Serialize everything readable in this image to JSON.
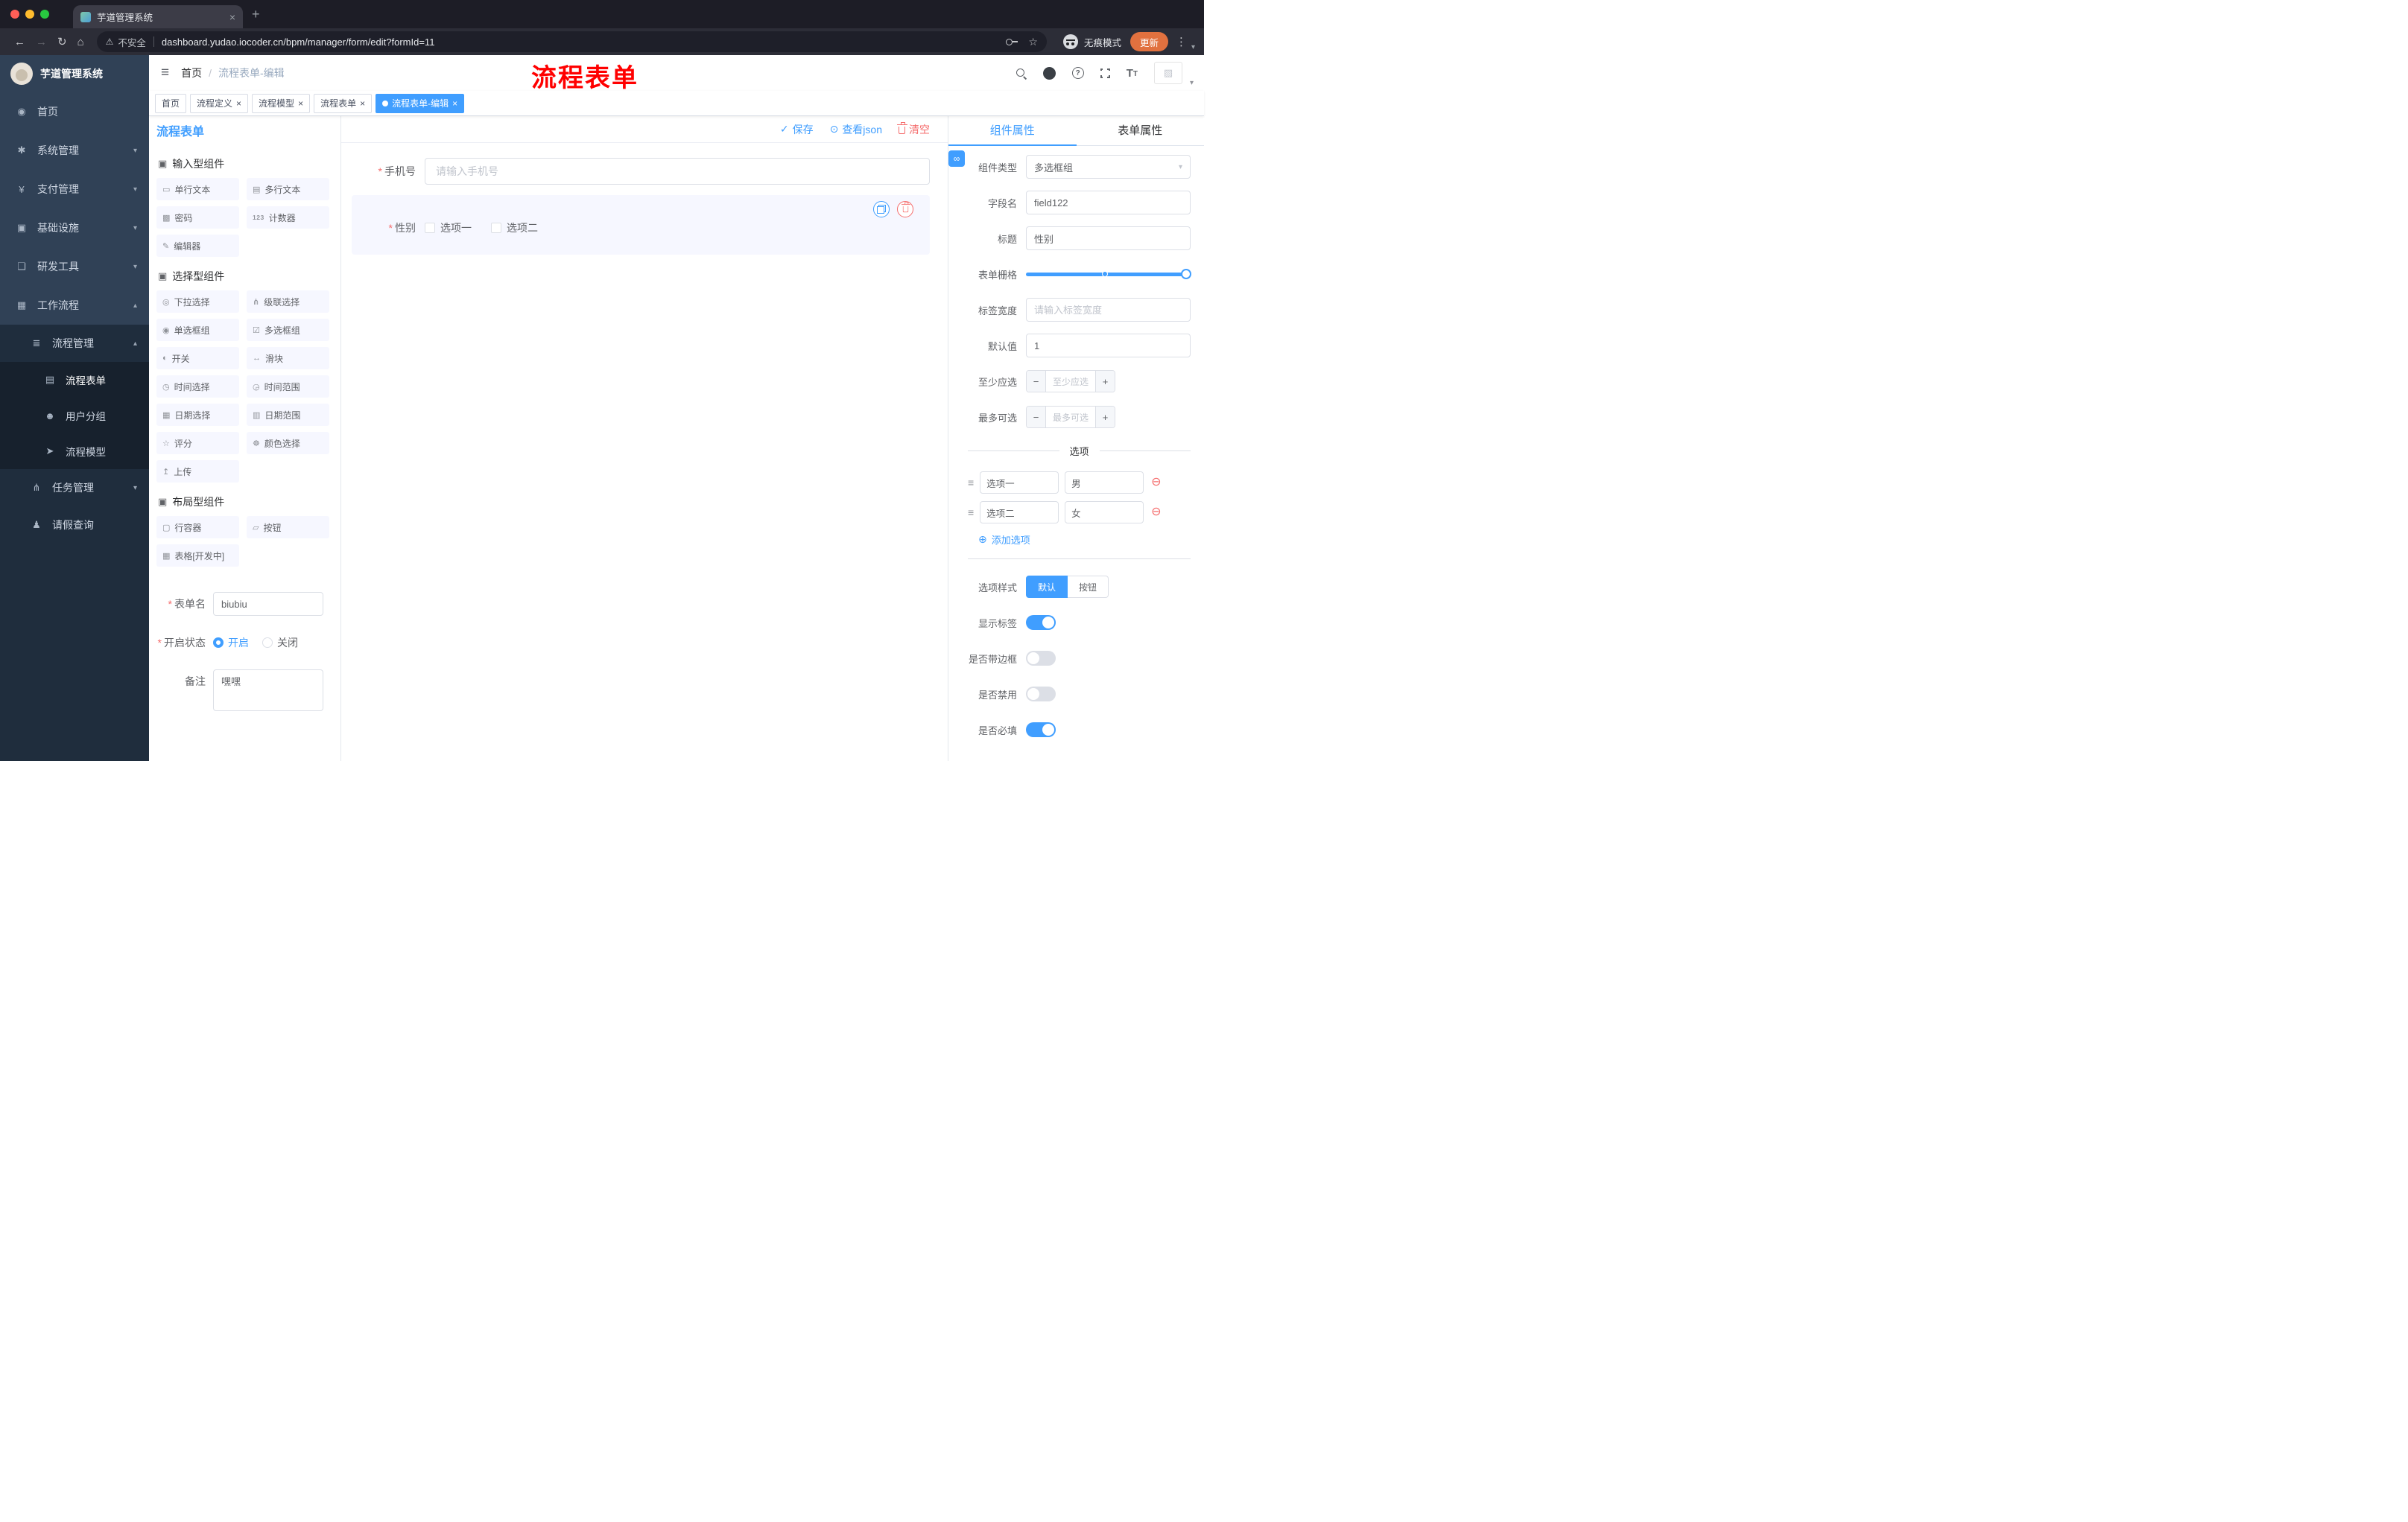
{
  "browser": {
    "tab_title": "芋道管理系统",
    "security_label": "不安全",
    "url": "dashboard.yudao.iocoder.cn/bpm/manager/form/edit?formId=11",
    "incognito_label": "无痕模式",
    "update_label": "更新"
  },
  "annotation": {
    "text": "流程表单",
    "color": "#ff0000"
  },
  "sidebar": {
    "logo_title": "芋道管理系统",
    "items": [
      "首页",
      "系统管理",
      "支付管理",
      "基础设施",
      "研发工具",
      "工作流程"
    ],
    "submenu": {
      "process_mgmt": "流程管理",
      "children": [
        "流程表单",
        "用户分组",
        "流程模型"
      ],
      "task_mgmt": "任务管理",
      "leave_query": "请假查询"
    }
  },
  "header": {
    "breadcrumb_home": "首页",
    "separator": "/",
    "breadcrumb_current": "流程表单-编辑"
  },
  "tags": [
    "首页",
    "流程定义",
    "流程模型",
    "流程表单",
    "流程表单-编辑"
  ],
  "designer": {
    "panel_title": "流程表单",
    "toolbar": {
      "save": "保存",
      "view_json": "查看json",
      "clear": "清空"
    },
    "sections": [
      {
        "title": "输入型组件",
        "items": [
          "单行文本",
          "多行文本",
          "密码",
          "计数器",
          "编辑器"
        ],
        "item_icons": [
          "▭",
          "▤",
          "▩",
          "123",
          "✎"
        ]
      },
      {
        "title": "选择型组件",
        "items": [
          "下拉选择",
          "级联选择",
          "单选框组",
          "多选框组",
          "开关",
          "滑块",
          "时间选择",
          "时间范围",
          "日期选择",
          "日期范围",
          "评分",
          "颜色选择",
          "上传"
        ],
        "item_icons": [
          "◎",
          "⋔",
          "◉",
          "☑",
          "◐",
          "↔",
          "◷",
          "◶",
          "▦",
          "▥",
          "☆",
          "☸",
          "↥"
        ]
      },
      {
        "title": "布局型组件",
        "items": [
          "行容器",
          "按钮",
          "表格[开发中]"
        ],
        "item_icons": [
          "▢",
          "▱",
          "▦"
        ]
      }
    ],
    "meta": {
      "form_name_label": "表单名",
      "form_name_value": "biubiu",
      "status_label": "开启状态",
      "status_on": "开启",
      "status_off": "关闭",
      "remark_label": "备注",
      "remark_value": "嘿嘿"
    },
    "canvas": {
      "phone_label": "手机号",
      "phone_placeholder": "请输入手机号",
      "gender_label": "性别",
      "gender_options": [
        "选项一",
        "选项二"
      ]
    }
  },
  "props": {
    "tab_component": "组件属性",
    "tab_form": "表单属性",
    "rows": {
      "type_label": "组件类型",
      "type_value": "多选框组",
      "field_label": "字段名",
      "field_value": "field122",
      "title_label": "标题",
      "title_value": "性别",
      "grid_label": "表单栅格",
      "width_label": "标签宽度",
      "width_placeholder": "请输入标签宽度",
      "default_label": "默认值",
      "default_value": "1",
      "min_label": "至少应选",
      "min_placeholder": "至少应选",
      "max_label": "最多可选",
      "max_placeholder": "最多可选"
    },
    "options": {
      "divider": "选项",
      "rows": [
        {
          "label": "选项一",
          "value": "男"
        },
        {
          "label": "选项二",
          "value": "女"
        }
      ],
      "add": "添加选项"
    },
    "style": {
      "label": "选项样式",
      "default_btn": "默认",
      "button_btn": "按钮",
      "show_label": "显示标签",
      "border_label": "是否带边框",
      "disabled_label": "是否禁用",
      "required_label": "是否必填"
    }
  },
  "colors": {
    "accent": "#409eff",
    "danger": "#f56c6c",
    "annotation": "#ff0000",
    "sidebar_bg": "#304156",
    "submenu_bg": "#1f2d3d",
    "update_btn": "#e1713f"
  },
  "icons": {
    "hamburger": "≡",
    "close": "×",
    "plus": "+",
    "back_arrow": "←",
    "forward_arrow": "→",
    "reload": "↻",
    "home_nav": "⌂",
    "warning": "⚠",
    "star": "☆",
    "dots_vertical": "⋮",
    "caret_down": "▾",
    "caret_up": "▴",
    "check": "✓",
    "eye": "⊙",
    "link": "∞",
    "question_mark": "?",
    "letter_t": "T",
    "add_circle": "⊕",
    "remove_circle": "⊖",
    "minus": "−",
    "plus_sign": "+",
    "drag_handle": "≡",
    "required_mark": "*",
    "dot": "●",
    "image_placeholder": "▨",
    "menu_home": "◉",
    "menu_system": "✱",
    "menu_pay": "¥",
    "menu_infra": "▣",
    "menu_dev": "❑",
    "menu_workflow": "▦",
    "menu_process": "≣",
    "menu_form": "▤",
    "menu_group": "☻",
    "menu_model": "➤",
    "menu_task": "⋔",
    "menu_leave": "♟",
    "section_cube": "▣"
  }
}
